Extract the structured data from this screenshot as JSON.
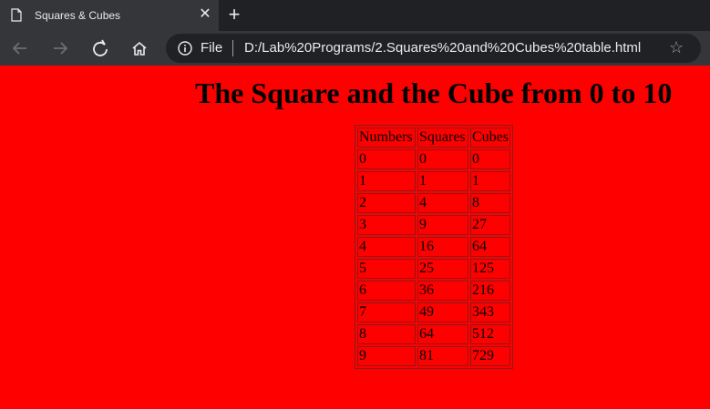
{
  "browser": {
    "tab_title": "Squares & Cubes",
    "scheme_label": "File",
    "url": "D:/Lab%20Programs/2.Squares%20and%20Cubes%20table.html"
  },
  "page": {
    "heading": "The Square and the Cube from 0 to 10",
    "table": {
      "headers": [
        "Numbers",
        "Squares",
        "Cubes"
      ],
      "rows": [
        [
          "0",
          "0",
          "0"
        ],
        [
          "1",
          "1",
          "1"
        ],
        [
          "2",
          "4",
          "8"
        ],
        [
          "3",
          "9",
          "27"
        ],
        [
          "4",
          "16",
          "64"
        ],
        [
          "5",
          "25",
          "125"
        ],
        [
          "6",
          "36",
          "216"
        ],
        [
          "7",
          "49",
          "343"
        ],
        [
          "8",
          "64",
          "512"
        ],
        [
          "9",
          "81",
          "729"
        ]
      ]
    }
  },
  "colors": {
    "page_background": "#ff0000",
    "chrome_dark": "#202124",
    "chrome_toolbar": "#35363a"
  },
  "icons": [
    "document-icon",
    "close-icon",
    "new-tab-icon",
    "back-icon",
    "forward-icon",
    "reload-icon",
    "home-icon",
    "info-icon",
    "star-icon"
  ]
}
